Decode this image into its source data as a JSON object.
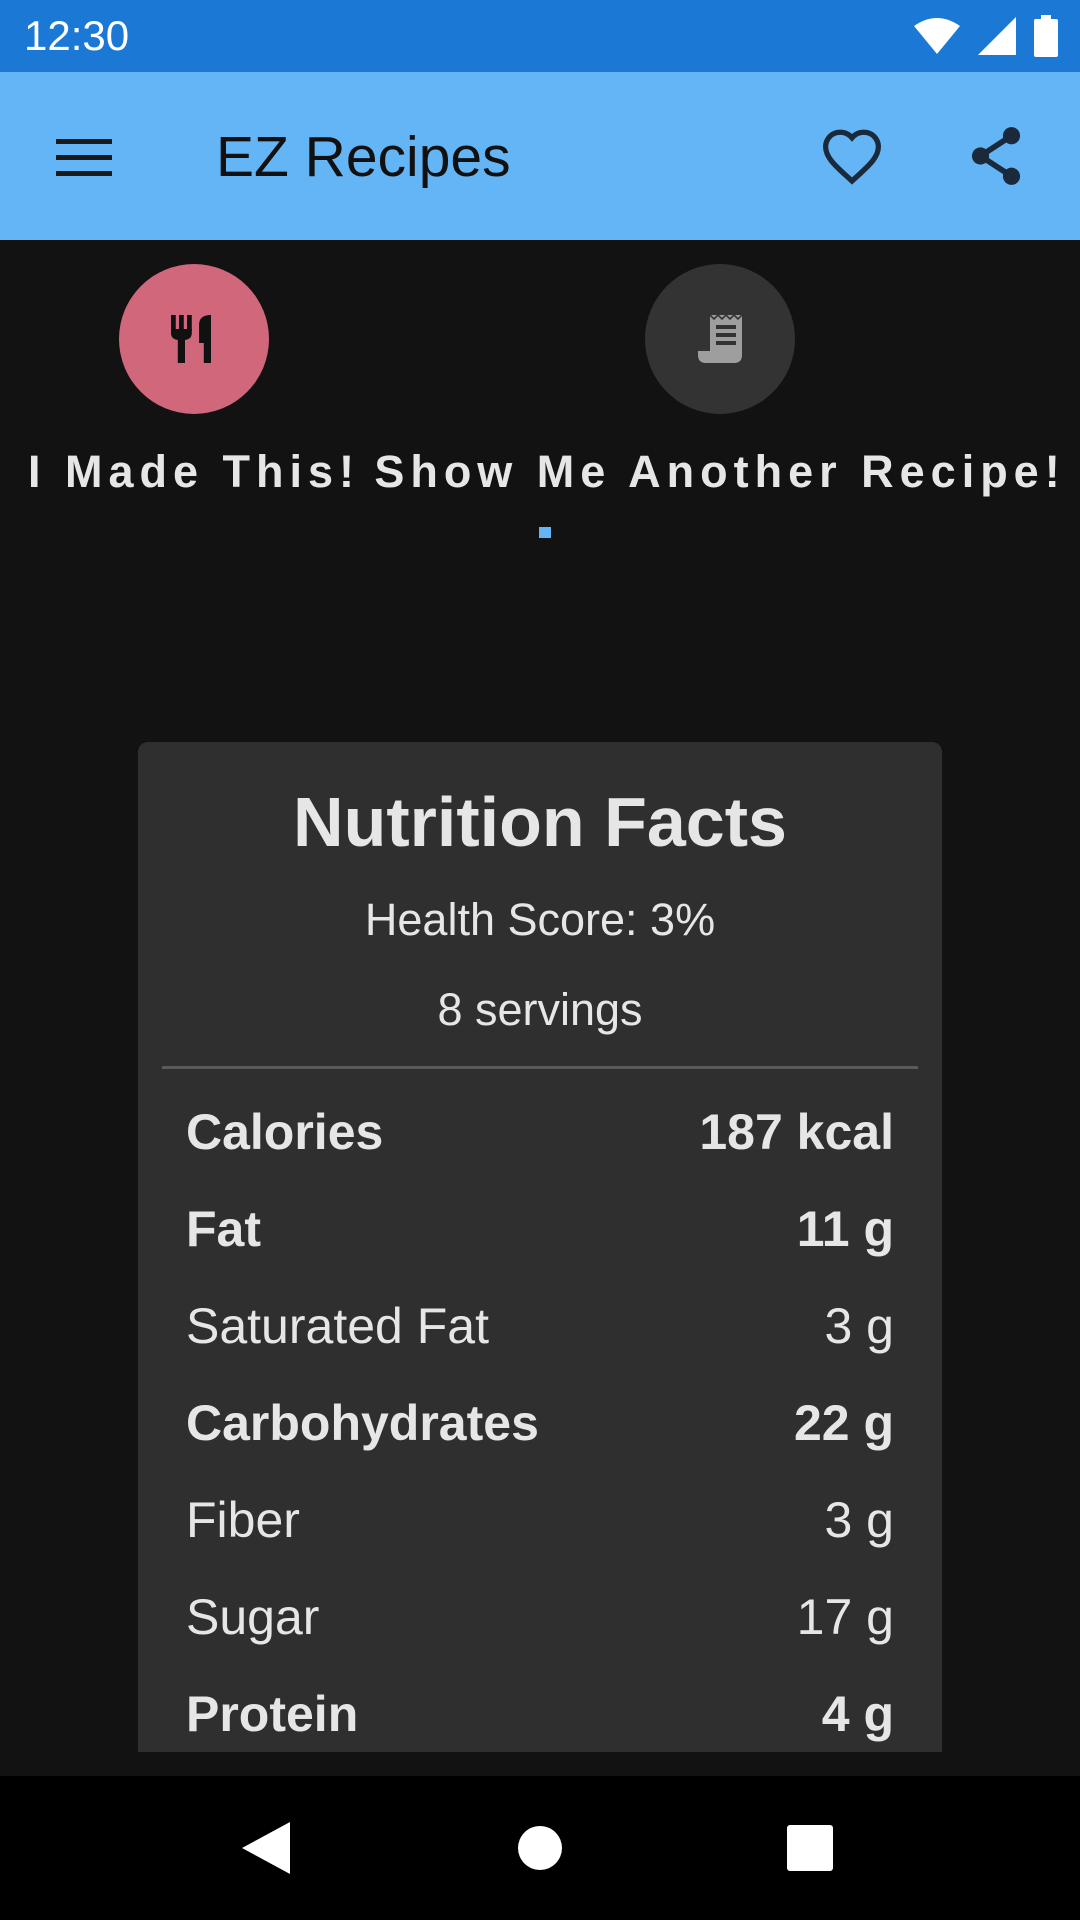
{
  "status_bar": {
    "time": "12:30",
    "icons": [
      "wifi-icon",
      "signal-icon",
      "battery-icon"
    ]
  },
  "app_bar": {
    "title": "EZ Recipes",
    "background": "#64b5f6",
    "icons": [
      "menu-icon",
      "heart-outline-icon",
      "share-icon"
    ]
  },
  "actions": [
    {
      "label": "I Made This!",
      "icon": "restaurant-icon",
      "color": "#d1677a"
    },
    {
      "label": "Show Me Another Recipe!",
      "icon": "receipt-icon",
      "color": "#333333"
    }
  ],
  "nutrition": {
    "title": "Nutrition Facts",
    "health_score": "Health Score: 3%",
    "servings": "8 servings",
    "rows": [
      {
        "name": "Calories",
        "value": "187 kcal",
        "bold": true
      },
      {
        "name": "Fat",
        "value": "11 g",
        "bold": true
      },
      {
        "name": "Saturated Fat",
        "value": "3 g",
        "bold": false
      },
      {
        "name": "Carbohydrates",
        "value": "22 g",
        "bold": true
      },
      {
        "name": "Fiber",
        "value": "3 g",
        "bold": false
      },
      {
        "name": "Sugar",
        "value": "17 g",
        "bold": false
      },
      {
        "name": "Protein",
        "value": "4 g",
        "bold": true
      }
    ]
  },
  "nav_bar": {
    "icons": [
      "back-icon",
      "home-icon",
      "recents-icon"
    ]
  }
}
